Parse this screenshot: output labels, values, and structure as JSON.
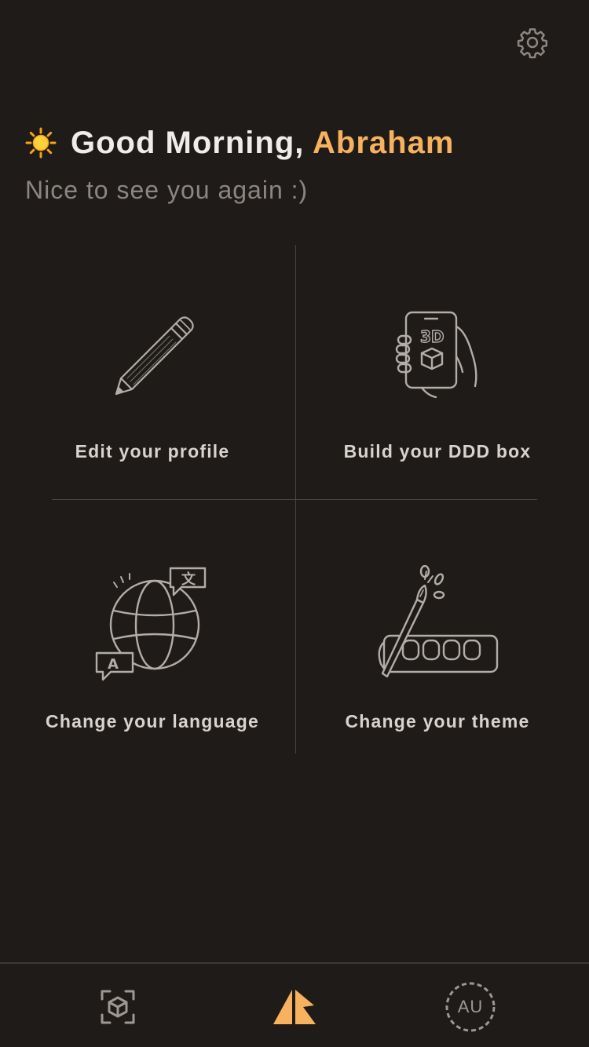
{
  "header": {
    "settings_icon": "gear-icon"
  },
  "greeting": {
    "icon": "sun-icon",
    "prefix": "Good Morning, ",
    "name": "Abraham",
    "subtitle": "Nice to see you again :)"
  },
  "tiles": [
    {
      "label": "Edit your profile",
      "icon": "pencil-icon"
    },
    {
      "label": "Build your DDD box",
      "icon": "phone-3d-icon",
      "icon_text": "3D"
    },
    {
      "label": "Change your language",
      "icon": "globe-translate-icon",
      "icon_text_a": "A",
      "icon_text_b": "文"
    },
    {
      "label": "Change your theme",
      "icon": "paint-palette-icon"
    }
  ],
  "bottom_nav": {
    "items": [
      {
        "name": "ar-scan",
        "icon": "ar-cube-scan-icon"
      },
      {
        "name": "home",
        "icon": "app-logo-icon"
      },
      {
        "name": "profile",
        "icon": "avatar-icon",
        "initials": "AU"
      }
    ]
  },
  "colors": {
    "background": "#1f1b18",
    "accent": "#f6b25e",
    "text_primary": "#f0ece9",
    "text_secondary": "#8c8683",
    "divider": "#4a4643",
    "icon": "#9e9895"
  }
}
